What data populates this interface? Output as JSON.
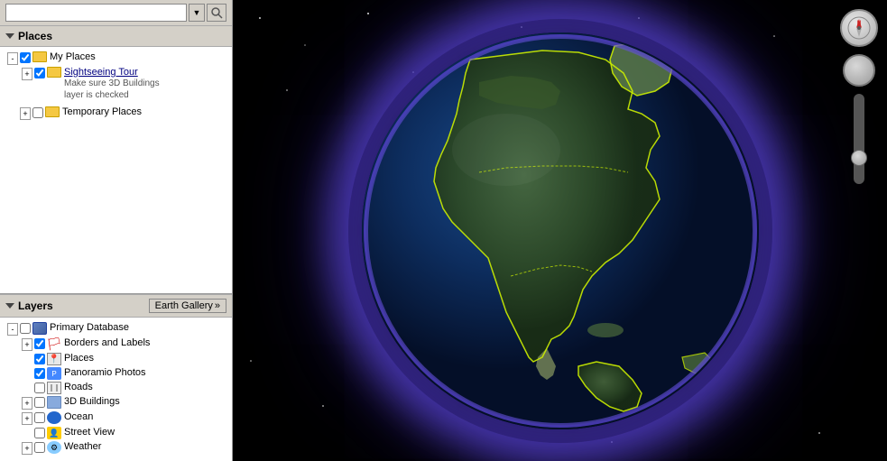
{
  "search": {
    "placeholder": "",
    "dropdown_label": "▼",
    "go_label": "🔍"
  },
  "places": {
    "section_label": "Places",
    "items": [
      {
        "id": "my-places",
        "indent": 1,
        "label": "My Places",
        "has_expand": true,
        "expand_symbol": "-",
        "checked": true,
        "type": "folder"
      },
      {
        "id": "sightseeing-tour",
        "indent": 2,
        "label": "Sightseeing Tour",
        "has_expand": true,
        "expand_symbol": "+",
        "checked": true,
        "type": "folder",
        "subtext": "Make sure 3D Buildings\nlayer is checked"
      },
      {
        "id": "temporary-places",
        "indent": 1,
        "label": "Temporary Places",
        "has_expand": true,
        "expand_symbol": "+",
        "checked": false,
        "type": "folder"
      }
    ]
  },
  "layers": {
    "section_label": "Layers",
    "earth_gallery_label": "Earth Gallery",
    "earth_gallery_arrow": "»",
    "items": [
      {
        "id": "primary-database",
        "indent": 1,
        "label": "Primary Database",
        "has_expand": true,
        "expand_symbol": "-",
        "checked": false,
        "type": "db"
      },
      {
        "id": "borders-labels",
        "indent": 2,
        "label": "Borders and Labels",
        "has_expand": true,
        "expand_symbol": "+",
        "checked": true,
        "type": "borders"
      },
      {
        "id": "places",
        "indent": 2,
        "label": "Places",
        "has_expand": false,
        "checked": true,
        "type": "places"
      },
      {
        "id": "panoramio",
        "indent": 2,
        "label": "Panoramio Photos",
        "has_expand": false,
        "checked": true,
        "type": "panoramio"
      },
      {
        "id": "roads",
        "indent": 2,
        "label": "Roads",
        "has_expand": false,
        "checked": false,
        "type": "roads"
      },
      {
        "id": "3d-buildings",
        "indent": 2,
        "label": "3D Buildings",
        "has_expand": true,
        "expand_symbol": "+",
        "checked": false,
        "type": "3d"
      },
      {
        "id": "ocean",
        "indent": 2,
        "label": "Ocean",
        "has_expand": true,
        "expand_symbol": "+",
        "checked": false,
        "type": "ocean"
      },
      {
        "id": "street-view",
        "indent": 2,
        "label": "Street View",
        "has_expand": false,
        "checked": false,
        "type": "street"
      },
      {
        "id": "weather",
        "indent": 2,
        "label": "Weather",
        "has_expand": true,
        "expand_symbol": "+",
        "checked": false,
        "type": "weather"
      }
    ]
  },
  "controls": {
    "compass_label": "N",
    "zoom_in_label": "+",
    "zoom_out_label": "-"
  }
}
